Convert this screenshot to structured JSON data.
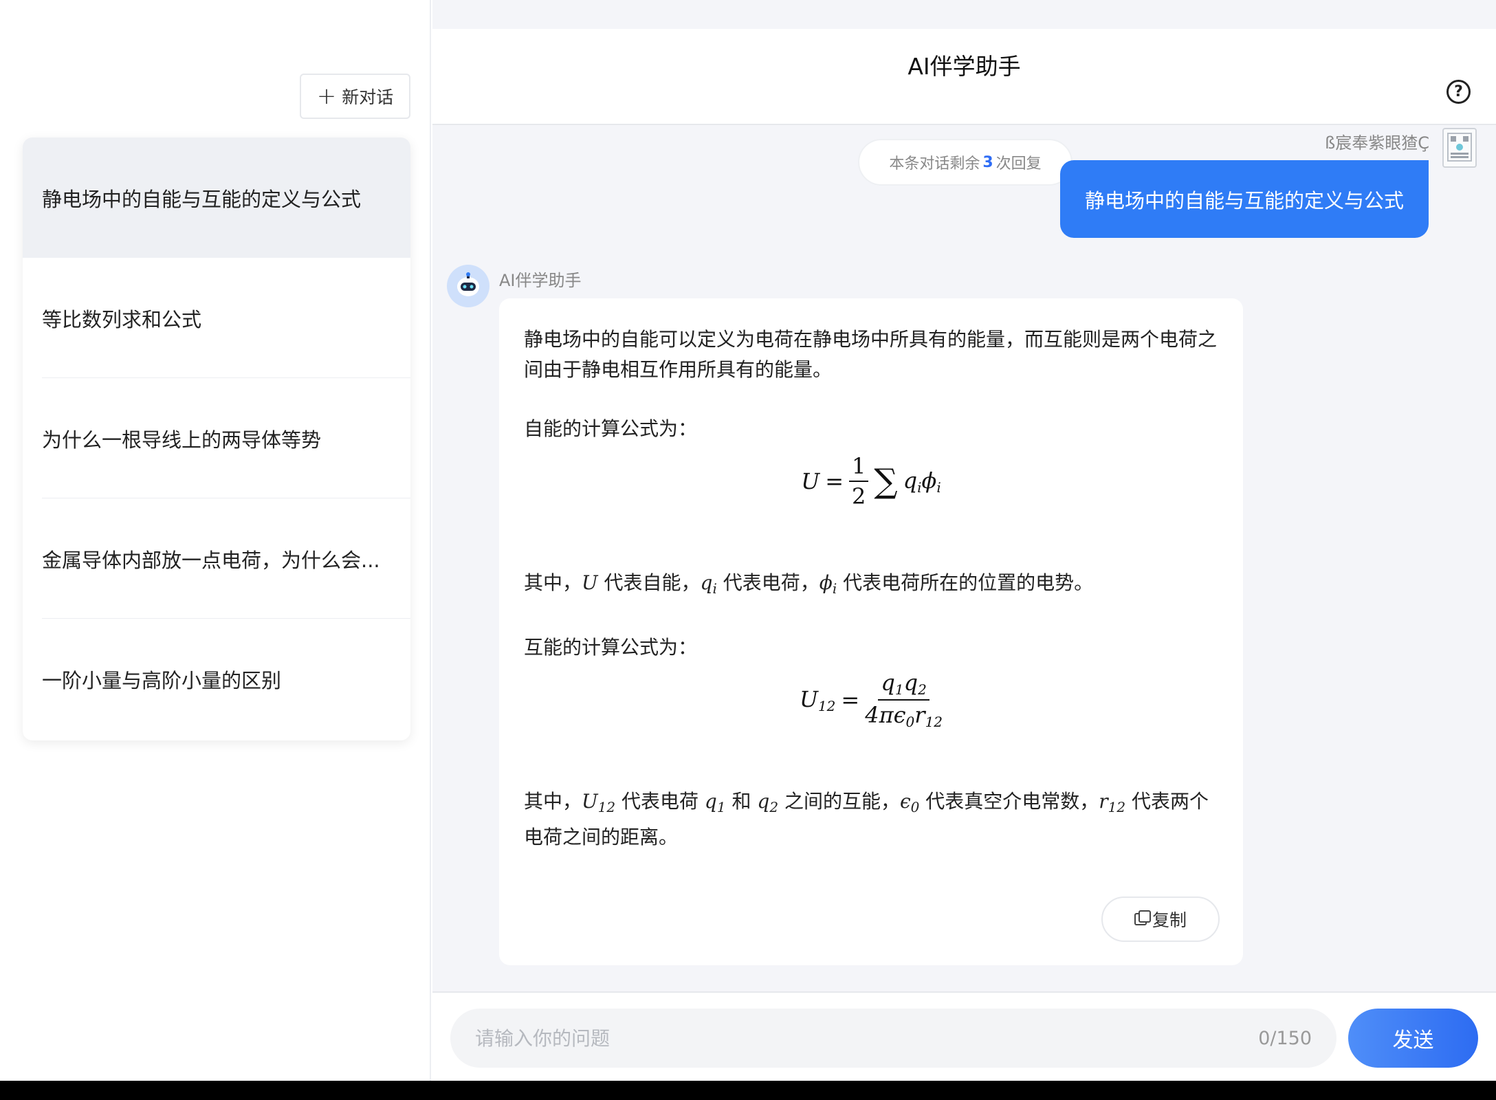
{
  "sidebar": {
    "new_chat_label": "新对话",
    "history": [
      {
        "label": "静电场中的自能与互能的定义与公式",
        "active": true
      },
      {
        "label": "等比数列求和公式",
        "active": false
      },
      {
        "label": "为什么一根导线上的两导体等势",
        "active": false
      },
      {
        "label": "金属导体内部放一点电荷，为什么会...",
        "active": false
      },
      {
        "label": "一阶小量与高阶小量的区别",
        "active": false
      }
    ]
  },
  "header": {
    "title": "AI伴学助手",
    "help_icon": "question-circle-icon"
  },
  "conversation": {
    "remaining_prefix": "本条对话剩余",
    "remaining_count": "3",
    "remaining_suffix": "次回复",
    "user_name": "ß宸奉紫眼猹Ç",
    "user_message": "静电场中的自能与互能的定义与公式",
    "bot_name": "AI伴学助手",
    "bot_reply": {
      "intro": "静电场中的自能可以定义为电荷在静电场中所具有的能量，而互能则是两个电荷之间由于静电相互作用所具有的能量。",
      "self_energy_heading": "自能的计算公式为：",
      "self_energy_explain": {
        "p1": "其中，",
        "U": "U",
        "p2": " 代表自能，",
        "q": "q",
        "qi": "i",
        "p3": " 代表电荷，",
        "phi": "ϕ",
        "phii": "i",
        "p4": " 代表电荷所在的位置的电势。"
      },
      "mutual_energy_heading": "互能的计算公式为：",
      "mutual_energy_explain": {
        "p1": "其中，",
        "U12": "U",
        "U12sub": "12",
        "p2": " 代表电荷 ",
        "q1": "q",
        "q1sub": "1",
        "p3": " 和 ",
        "q2": "q",
        "q2sub": "2",
        "p4": " 之间的互能，",
        "eps": "ϵ",
        "epssub": "0",
        "p5": " 代表真空介电常数，",
        "r": "r",
        "rsub": "12",
        "p6": " 代表两个电荷之间的距离。"
      },
      "copy_label": "复制"
    }
  },
  "input": {
    "placeholder": "请输入你的问题",
    "value": "",
    "count": "0/150",
    "send_label": "发送"
  },
  "colors": {
    "accent": "#2f7cf6",
    "active_item_bg": "#eef0f4",
    "main_bg": "#f4f5f9"
  }
}
